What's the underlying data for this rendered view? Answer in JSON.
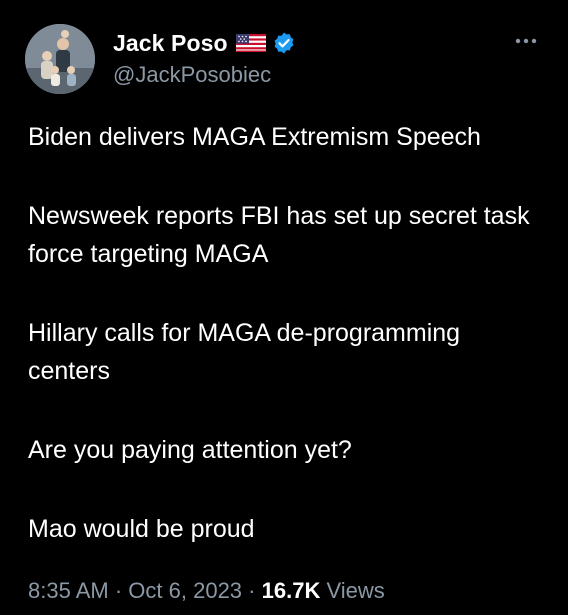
{
  "author": {
    "display_name": "Jack Poso",
    "handle": "@JackPosobiec",
    "badges": [
      "us-flag-icon",
      "verified-badge-icon"
    ],
    "verified_color": "#1d9bf0"
  },
  "tweet": {
    "paragraphs": [
      "Biden delivers MAGA Extremism Speech",
      "Newsweek reports FBI has set up secret task force targeting MAGA",
      "Hillary calls for MAGA de-programming centers",
      "Are you paying attention yet?",
      "Mao would be proud"
    ],
    "time": "8:35 AM",
    "date": "Oct 6, 2023",
    "separator": "·",
    "views_count": "16.7K",
    "views_label": "Views"
  },
  "colors": {
    "background": "#000000",
    "text": "#ffffff",
    "secondary": "#8b98a5"
  }
}
